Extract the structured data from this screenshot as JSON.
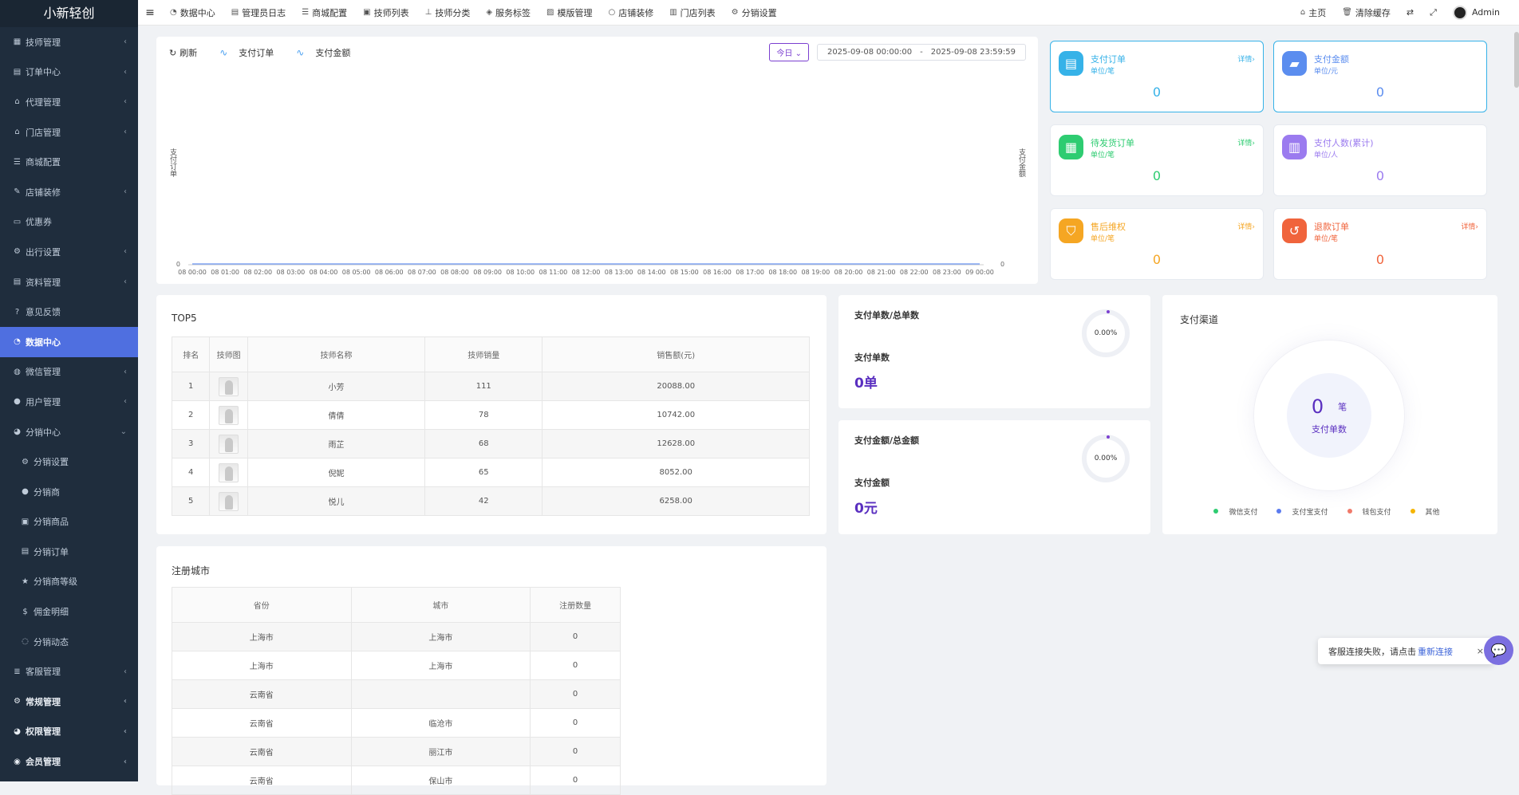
{
  "brand": "小新轻创",
  "sidebar": {
    "items": [
      {
        "label": "技师管理",
        "icon": "grid-icon",
        "arrow": "‹"
      },
      {
        "label": "订单中心",
        "icon": "doc-icon",
        "arrow": "‹"
      },
      {
        "label": "代理管理",
        "icon": "bank-icon",
        "arrow": "‹"
      },
      {
        "label": "门店管理",
        "icon": "bank-icon",
        "arrow": "‹"
      },
      {
        "label": "商城配置",
        "icon": "sliders-icon",
        "arrow": ""
      },
      {
        "label": "店铺装修",
        "icon": "brush-icon",
        "arrow": "‹"
      },
      {
        "label": "优惠券",
        "icon": "coupon-icon",
        "arrow": ""
      },
      {
        "label": "出行设置",
        "icon": "cogs-icon",
        "arrow": "‹"
      },
      {
        "label": "资料管理",
        "icon": "doc-icon",
        "arrow": "‹"
      },
      {
        "label": "意见反馈",
        "icon": "question-icon",
        "arrow": ""
      },
      {
        "label": "数据中心",
        "icon": "dashboard-icon",
        "arrow": "",
        "active": true
      },
      {
        "label": "微信管理",
        "icon": "wechat-icon",
        "arrow": "‹"
      },
      {
        "label": "用户管理",
        "icon": "user-icon",
        "arrow": "‹"
      },
      {
        "label": "分销中心",
        "icon": "users-icon",
        "arrow": "⌄"
      },
      {
        "label": "分销设置",
        "icon": "cog-icon",
        "arrow": "",
        "sub": true
      },
      {
        "label": "分销商",
        "icon": "user-icon",
        "arrow": "",
        "sub": true
      },
      {
        "label": "分销商品",
        "icon": "briefcase-icon",
        "arrow": "",
        "sub": true
      },
      {
        "label": "分销订单",
        "icon": "doc-icon",
        "arrow": "",
        "sub": true
      },
      {
        "label": "分销商等级",
        "icon": "star-icon",
        "arrow": "",
        "sub": true
      },
      {
        "label": "佣金明细",
        "icon": "dollar-icon",
        "arrow": "",
        "sub": true
      },
      {
        "label": "分销动态",
        "icon": "comments-icon",
        "arrow": "",
        "sub": true
      },
      {
        "label": "客服管理",
        "icon": "list-icon",
        "arrow": "‹"
      },
      {
        "label": "常规管理",
        "icon": "cogs-icon",
        "arrow": "‹",
        "bottom": true
      },
      {
        "label": "权限管理",
        "icon": "group-icon",
        "arrow": "‹",
        "bottom": true
      },
      {
        "label": "会员管理",
        "icon": "user-circle-icon",
        "arrow": "‹",
        "bottom": true
      }
    ]
  },
  "topnav": {
    "items": [
      {
        "label": "数据中心",
        "icon": "dashboard-icon"
      },
      {
        "label": "管理员日志",
        "icon": "list-alt-icon"
      },
      {
        "label": "商城配置",
        "icon": "sliders-icon"
      },
      {
        "label": "技师列表",
        "icon": "briefcase-icon"
      },
      {
        "label": "技师分类",
        "icon": "sitemap-icon"
      },
      {
        "label": "服务标签",
        "icon": "tags-icon"
      },
      {
        "label": "模版管理",
        "icon": "cubes-icon"
      },
      {
        "label": "店铺装修",
        "icon": "circle-icon"
      },
      {
        "label": "门店列表",
        "icon": "building-icon"
      },
      {
        "label": "分销设置",
        "icon": "cog-icon"
      }
    ],
    "right": {
      "home": "主页",
      "clear_cache": "清除缓存",
      "user": "Admin"
    }
  },
  "chart": {
    "refresh": "刷新",
    "legend1": "支付订单",
    "legend2": "支付金额",
    "today": "今日",
    "range_start": "2025-09-08 00:00:00",
    "range_sep": "-",
    "range_end": "2025-09-08 23:59:59",
    "left_axis_label": "支付订单",
    "right_axis_label": "支付金额",
    "zero_left": "0",
    "zero_right": "0",
    "line_color": "#4a7ef0"
  },
  "chart_data": {
    "type": "line",
    "x": [
      "08 00:00",
      "08 01:00",
      "08 02:00",
      "08 03:00",
      "08 04:00",
      "08 05:00",
      "08 06:00",
      "08 07:00",
      "08 08:00",
      "08 09:00",
      "08 10:00",
      "08 11:00",
      "08 12:00",
      "08 13:00",
      "08 14:00",
      "08 15:00",
      "08 16:00",
      "08 17:00",
      "08 18:00",
      "08 19:00",
      "08 20:00",
      "08 21:00",
      "08 22:00",
      "08 23:00",
      "09 00:00"
    ],
    "series": [
      {
        "name": "支付订单",
        "values": [
          0,
          0,
          0,
          0,
          0,
          0,
          0,
          0,
          0,
          0,
          0,
          0,
          0,
          0,
          0,
          0,
          0,
          0,
          0,
          0,
          0,
          0,
          0,
          0,
          0
        ]
      },
      {
        "name": "支付金额",
        "values": [
          0,
          0,
          0,
          0,
          0,
          0,
          0,
          0,
          0,
          0,
          0,
          0,
          0,
          0,
          0,
          0,
          0,
          0,
          0,
          0,
          0,
          0,
          0,
          0,
          0
        ]
      }
    ],
    "ylabel": "支付订单",
    "y2label": "支付金额"
  },
  "stats": [
    {
      "title": "支付订单",
      "unit": "单位/笔",
      "detail": "详情›",
      "value": "0",
      "color": "#36b2e8",
      "icon": "file-icon"
    },
    {
      "title": "支付金额",
      "unit": "单位/元",
      "detail": "",
      "value": "0",
      "color": "#5b8def",
      "icon": "wallet-icon"
    },
    {
      "title": "待发货订单",
      "unit": "单位/笔",
      "detail": "详情›",
      "value": "0",
      "color": "#2ecc71",
      "icon": "calendar-icon"
    },
    {
      "title": "支付人数(累计)",
      "unit": "单位/人",
      "detail": "",
      "value": "0",
      "color": "#9b7bef",
      "icon": "bar-chart-icon"
    },
    {
      "title": "售后维权",
      "unit": "单位/笔",
      "detail": "详情›",
      "value": "0",
      "color": "#f5a623",
      "icon": "shield-icon"
    },
    {
      "title": "退款订单",
      "unit": "单位/笔",
      "detail": "详情›",
      "value": "0",
      "color": "#f0643c",
      "icon": "refund-icon"
    }
  ],
  "top5": {
    "title": "TOP5",
    "headers": [
      "排名",
      "技师图",
      "技师名称",
      "技师销量",
      "销售额(元)"
    ],
    "rows": [
      {
        "rank": "1",
        "name": "小芳",
        "sales": "111",
        "amount": "20088.00"
      },
      {
        "rank": "2",
        "name": "倩倩",
        "sales": "78",
        "amount": "10742.00"
      },
      {
        "rank": "3",
        "name": "雨芷",
        "sales": "68",
        "amount": "12628.00"
      },
      {
        "rank": "4",
        "name": "倪妮",
        "sales": "65",
        "amount": "8052.00"
      },
      {
        "rank": "5",
        "name": "悦儿",
        "sales": "42",
        "amount": "6258.00"
      }
    ]
  },
  "orders_ratio": {
    "title": "支付单数/总单数",
    "percent": "0.00%",
    "label": "支付单数",
    "value": "0单"
  },
  "amount_ratio": {
    "title": "支付金额/总金额",
    "percent": "0.00%",
    "label": "支付金额",
    "value": "0元"
  },
  "channels": {
    "title": "支付渠道",
    "count": "0",
    "unit": "笔",
    "caption": "支付单数",
    "legend": [
      {
        "name": "微信支付",
        "color": "#2ecc71"
      },
      {
        "name": "支付宝支付",
        "color": "#5b7bef"
      },
      {
        "name": "钱包支付",
        "color": "#f07a6a"
      },
      {
        "name": "其他",
        "color": "#f5b400"
      }
    ]
  },
  "cities": {
    "title": "注册城市",
    "headers": [
      "省份",
      "城市",
      "注册数量"
    ],
    "rows": [
      {
        "province": "上海市",
        "city": "上海市",
        "count": "0"
      },
      {
        "province": "上海市",
        "city": "上海市",
        "count": "0"
      },
      {
        "province": "云南省",
        "city": "",
        "count": "0"
      },
      {
        "province": "云南省",
        "city": "临沧市",
        "count": "0"
      },
      {
        "province": "云南省",
        "city": "丽江市",
        "count": "0"
      },
      {
        "province": "云南省",
        "city": "保山市",
        "count": "0"
      }
    ]
  },
  "toast": {
    "text": "客服连接失败，请点击",
    "link": "重新连接",
    "close": "×"
  }
}
